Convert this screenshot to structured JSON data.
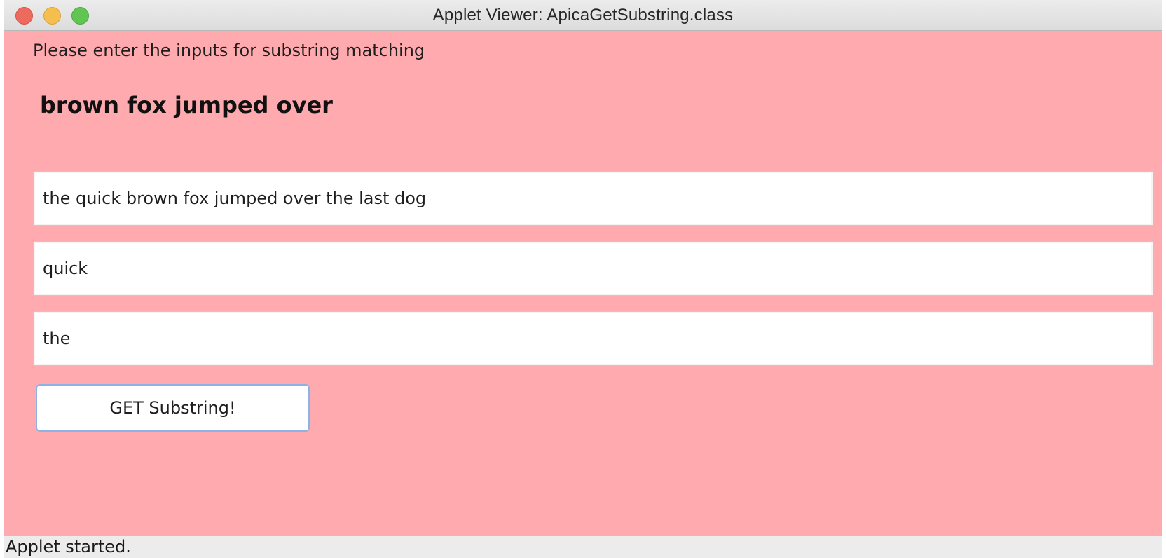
{
  "window": {
    "title": "Applet Viewer: ApicaGetSubstring.class"
  },
  "applet": {
    "prompt": "Please enter the inputs for substring matching",
    "result": "brown fox jumped over",
    "inputs": {
      "source_string": "the quick brown fox jumped over the last dog",
      "start_word": "quick",
      "end_word": "the"
    },
    "button_label": "GET Substring!",
    "background_color": "#ffaaae"
  },
  "status": {
    "text": "Applet started."
  }
}
